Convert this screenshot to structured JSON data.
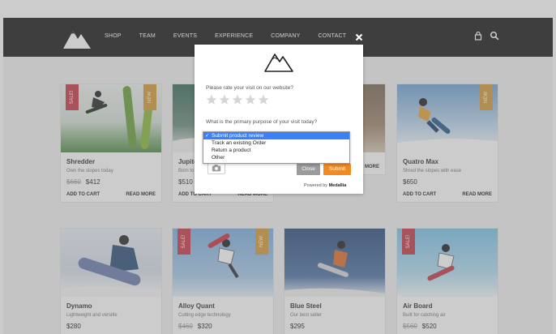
{
  "nav": {
    "links": [
      "SHOP",
      "TEAM",
      "EVENTS",
      "EXPERIENCE",
      "COMPANY",
      "CONTACT"
    ],
    "icons": [
      "lock-icon",
      "search-icon"
    ]
  },
  "products": [
    {
      "name": "Shredder",
      "subtitle": "Own the slopes today",
      "old_price": "$660",
      "price": "$412",
      "tags": [
        "SALE!",
        "NEW"
      ]
    },
    {
      "name": "Jupite",
      "subtitle": "Born to",
      "old_price": "",
      "price": "$510",
      "tags": []
    },
    {
      "name": "",
      "subtitle": "",
      "old_price": "",
      "price": "",
      "tags": []
    },
    {
      "name": "Quatro Max",
      "subtitle": "Shred the slopes with ease",
      "old_price": "",
      "price": "$650",
      "tags": [
        "NEW"
      ]
    },
    {
      "name": "Dynamo",
      "subtitle": "Lightweight and versitle",
      "old_price": "",
      "price": "$280",
      "tags": []
    },
    {
      "name": "Alloy Quant",
      "subtitle": "Cutting edge technology",
      "old_price": "$460",
      "price": "$320",
      "tags": [
        "SALE!",
        "NEW"
      ]
    },
    {
      "name": "Blue Steel",
      "subtitle": "Our best seller",
      "old_price": "",
      "price": "$295",
      "tags": []
    },
    {
      "name": "Air Board",
      "subtitle": "Built for catching air",
      "old_price": "$560",
      "price": "$520",
      "tags": [
        "SALE!"
      ]
    }
  ],
  "card_actions": {
    "add": "ADD TO CART",
    "read": "READ MORE"
  },
  "modal": {
    "rate_question": "Please rate your visit on our website?",
    "stars": 5,
    "purpose_question": "What is the primary purpose of your visit today?",
    "options": [
      "Submit product review",
      "Track an existing Order",
      "Return a product",
      "Other"
    ],
    "selected_index": 0,
    "close_label": "Close",
    "submit_label": "Submit",
    "powered_by": "Powered by",
    "brand": "Medallia"
  },
  "colors": {
    "nav_bg": "#1b1b1b",
    "sale": "#c73a4b",
    "new": "#d69b3a",
    "submit": "#f18a21",
    "selected": "#3b80f7"
  }
}
